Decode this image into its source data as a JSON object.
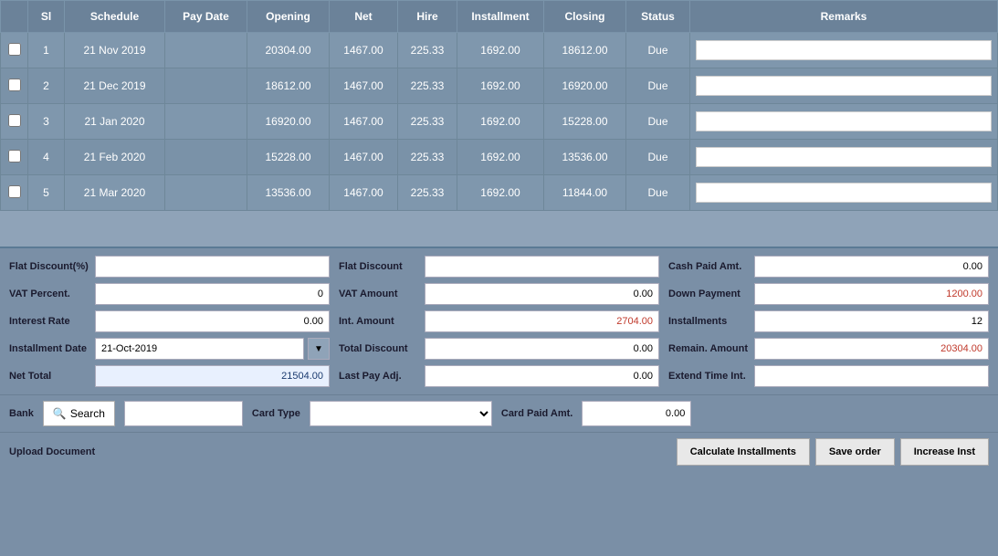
{
  "table": {
    "headers": [
      "",
      "Sl",
      "Schedule",
      "Pay Date",
      "Opening",
      "Net",
      "Hire",
      "Installment",
      "Closing",
      "Status",
      "Remarks"
    ],
    "rows": [
      {
        "sl": "1",
        "schedule": "21 Nov 2019",
        "pay_date": "",
        "opening": "20304.00",
        "net": "1467.00",
        "hire": "225.33",
        "installment": "1692.00",
        "closing": "18612.00",
        "status": "Due"
      },
      {
        "sl": "2",
        "schedule": "21 Dec 2019",
        "pay_date": "",
        "opening": "18612.00",
        "net": "1467.00",
        "hire": "225.33",
        "installment": "1692.00",
        "closing": "16920.00",
        "status": "Due"
      },
      {
        "sl": "3",
        "schedule": "21 Jan 2020",
        "pay_date": "",
        "opening": "16920.00",
        "net": "1467.00",
        "hire": "225.33",
        "installment": "1692.00",
        "closing": "15228.00",
        "status": "Due"
      },
      {
        "sl": "4",
        "schedule": "21 Feb 2020",
        "pay_date": "",
        "opening": "15228.00",
        "net": "1467.00",
        "hire": "225.33",
        "installment": "1692.00",
        "closing": "13536.00",
        "status": "Due"
      },
      {
        "sl": "5",
        "schedule": "21 Mar 2020",
        "pay_date": "",
        "opening": "13536.00",
        "net": "1467.00",
        "hire": "225.33",
        "installment": "1692.00",
        "closing": "11844.00",
        "status": "Due"
      }
    ]
  },
  "form": {
    "flat_discount_pct_label": "Flat Discount(%)",
    "flat_discount_pct_value": "",
    "flat_discount_label": "Flat Discount",
    "flat_discount_value": "",
    "cash_paid_amt_label": "Cash Paid Amt.",
    "cash_paid_amt_value": "0.00",
    "vat_percent_label": "VAT Percent.",
    "vat_percent_value": "0",
    "vat_amount_label": "VAT Amount",
    "vat_amount_value": "0.00",
    "down_payment_label": "Down Payment",
    "down_payment_value": "1200.00",
    "interest_rate_label": "Interest Rate",
    "interest_rate_value": "0.00",
    "int_amount_label": "Int. Amount",
    "int_amount_value": "2704.00",
    "installments_label": "Installments",
    "installments_value": "12",
    "installment_date_label": "Installment Date",
    "installment_date_value": "21-Oct-2019",
    "total_discount_label": "Total Discount",
    "total_discount_value": "0.00",
    "remain_amount_label": "Remain. Amount",
    "remain_amount_value": "20304.00",
    "net_total_label": "Net Total",
    "net_total_value": "21504.00",
    "last_pay_adj_label": "Last Pay Adj.",
    "last_pay_adj_value": "0.00",
    "extend_time_int_label": "Extend Time Int.",
    "extend_time_int_value": ""
  },
  "bottom_bar": {
    "bank_label": "Bank",
    "search_label": "Search",
    "card_type_label": "Card Type",
    "card_paid_amt_label": "Card Paid Amt.",
    "card_paid_amt_value": "0.00"
  },
  "footer": {
    "upload_label": "Upload Document",
    "calc_btn": "Calculate Installments",
    "save_btn": "Save order",
    "increase_btn": "Increase Inst"
  },
  "icons": {
    "search": "🔍",
    "dropdown_arrow": "▼"
  }
}
